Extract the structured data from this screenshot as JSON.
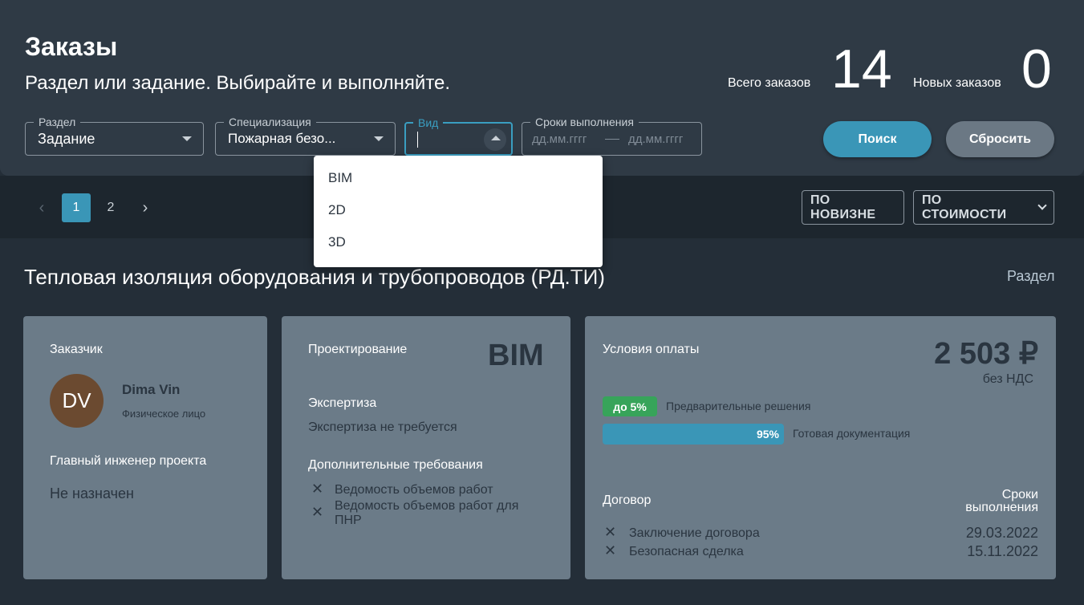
{
  "header": {
    "title": "Заказы",
    "subtitle": "Раздел или задание. Выбирайте и выполняйте.",
    "stats": {
      "total_label": "Всего заказов",
      "total_value": "14",
      "new_label": "Новых заказов",
      "new_value": "0"
    }
  },
  "filters": {
    "section": {
      "label": "Раздел",
      "value": "Задание"
    },
    "specialization": {
      "label": "Специализация",
      "value": "Пожарная безо..."
    },
    "type": {
      "label": "Вид",
      "value": ""
    },
    "deadline": {
      "label": "Сроки выполнения",
      "from_placeholder": "дд.мм.гггг",
      "to_placeholder": "дд.мм.гггг"
    },
    "search_label": "Поиск",
    "reset_label": "Сбросить"
  },
  "dropdown": {
    "options": [
      "BIM",
      "2D",
      "3D"
    ]
  },
  "pagination": {
    "prev": "‹",
    "pages": [
      "1",
      "2"
    ],
    "current": "1",
    "next": "›"
  },
  "sort": {
    "newest_label": "ПО НОВИЗНЕ",
    "price_label": "ПО СТОИМОСТИ"
  },
  "section": {
    "title": "Тепловая изоляция оборудования и трубопроводов (РД.ТИ)",
    "link": "Раздел"
  },
  "customer_card": {
    "customer_label": "Заказчик",
    "initials": "DV",
    "name": "Dima Vin",
    "type": "Физическое лицо",
    "engineer_label": "Главный инженер проекта",
    "engineer_value": "Не назначен",
    "avatar_color": "#6b4a30"
  },
  "project_card": {
    "design_label": "Проектирование",
    "design_type": "BIM",
    "expertise_label": "Экспертиза",
    "expertise_value": "Экспертиза не требуется",
    "requirements_label": "Дополнительные требования",
    "requirements": [
      "Ведомость объемов работ",
      "Ведомость объемов работ для ПНР"
    ]
  },
  "payment_card": {
    "label": "Условия оплаты",
    "price": "2 503 ₽",
    "vat": "без НДС",
    "stages": [
      {
        "badge": "до 5%",
        "label": "Предварительные решения",
        "fraction": 0.05,
        "color": "#37a45a"
      },
      {
        "badge": "95%",
        "label": "Готовая документация",
        "fraction": 0.95,
        "color": "#3a96b7"
      }
    ],
    "contract_label": "Договор",
    "deadline_label": "Сроки выполнения",
    "contract_items": [
      {
        "label": "Заключение договора",
        "date": "29.03.2022"
      },
      {
        "label": "Безопасная сделка",
        "date": "15.11.2022"
      }
    ]
  },
  "icons": {
    "close": "close-icon",
    "chevron_down": "chevron-down-icon",
    "chevron_up": "chevron-up-icon"
  },
  "colors": {
    "accent": "#3a96b7",
    "success": "#37a45a",
    "card": "#6b7b88",
    "background": "#242e38"
  }
}
